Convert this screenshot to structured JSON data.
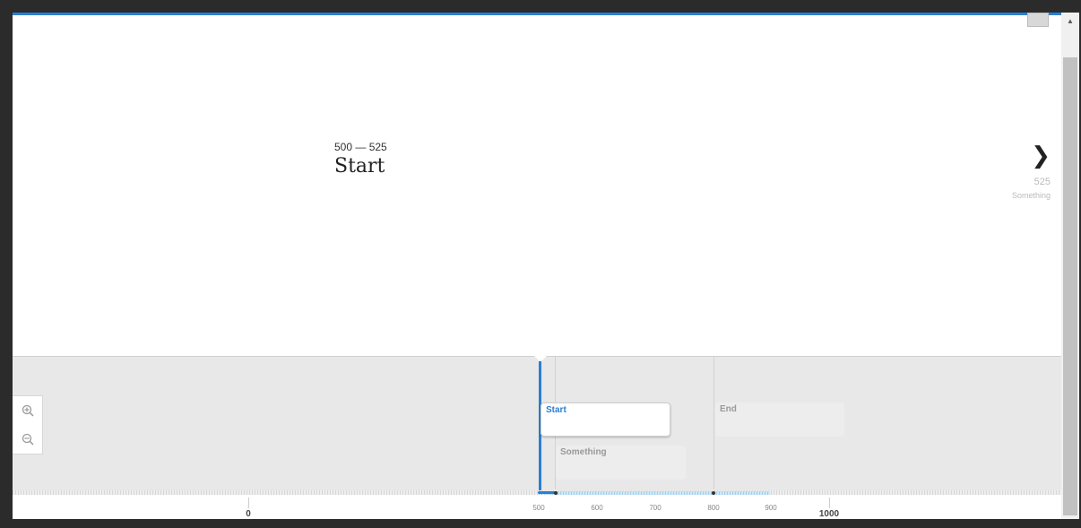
{
  "slide": {
    "date": "500 — 525",
    "headline": "Start"
  },
  "next": {
    "date": "525",
    "title": "Something"
  },
  "navigator": {
    "flags": [
      {
        "title": "Start",
        "state": "active"
      },
      {
        "title": "Something",
        "state": "inactive"
      },
      {
        "title": "End",
        "state": "inactive"
      }
    ],
    "time_axis": {
      "major_labels": [
        "0",
        "1000"
      ],
      "minor_labels": [
        "500",
        "600",
        "700",
        "800",
        "900"
      ]
    },
    "zoom": {
      "in_icon": "zoom-in-icon",
      "out_icon": "zoom-out-icon"
    }
  },
  "icons": {
    "next": "chevron-right-icon",
    "scroll_up": "scroll-up-arrow-icon"
  },
  "colors": {
    "accent": "#2a7fd1",
    "nav_bg": "#e8e8e8"
  }
}
